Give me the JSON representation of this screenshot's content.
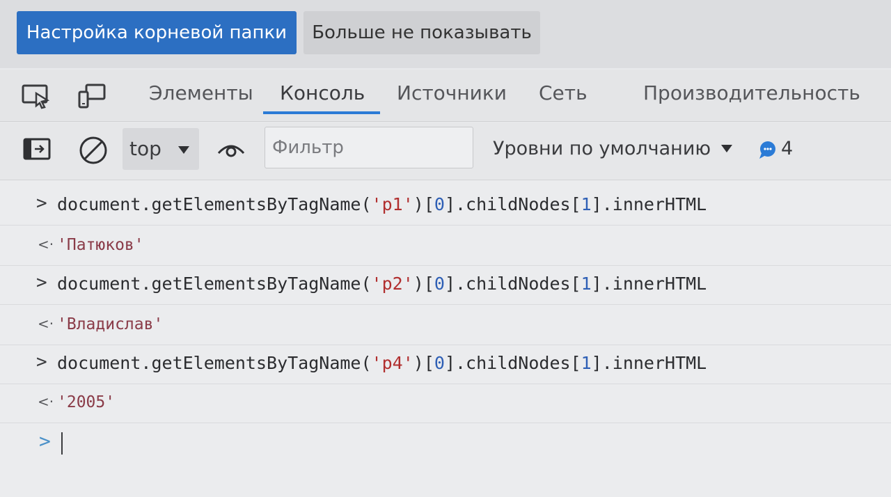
{
  "infobar": {
    "primary_button": "Настройка корневой папки",
    "secondary_button": "Больше не показывать"
  },
  "tabs": {
    "items": [
      "Элементы",
      "Консоль",
      "Источники",
      "Сеть",
      "Производительность"
    ],
    "active": "Консоль"
  },
  "toolbar": {
    "context": "top",
    "filter_placeholder": "Фильтр",
    "levels": "Уровни по умолчанию",
    "message_count": "4"
  },
  "console": {
    "entries": [
      {
        "input": {
          "pre": "document.getElementsByTagName(",
          "arg": "'p1'",
          "mid": ")[",
          "index": "0",
          "mid2": "].childNodes[",
          "index2": "1",
          "post": "].innerHTML"
        },
        "result": "'Патюков'"
      },
      {
        "input": {
          "pre": "document.getElementsByTagName(",
          "arg": "'p2'",
          "mid": ")[",
          "index": "0",
          "mid2": "].childNodes[",
          "index2": "1",
          "post": "].innerHTML"
        },
        "result": "'Владислав'"
      },
      {
        "input": {
          "pre": "document.getElementsByTagName(",
          "arg": "'p4'",
          "mid": ")[",
          "index": "0",
          "mid2": "].childNodes[",
          "index2": "1",
          "post": "].innerHTML"
        },
        "result": "'2005'"
      }
    ],
    "prompt_symbol": ">",
    "result_symbol": "<·"
  },
  "colors": {
    "accent": "#2b7bd6",
    "primary_button": "#2c6fc2",
    "string": "#b12f2f",
    "number": "#2e5fb5",
    "result_string": "#8a3b48"
  },
  "icons": [
    "inspect-element-icon",
    "device-emulation-icon",
    "sidebar-toggle-icon",
    "clear-console-icon",
    "eye-icon",
    "message-bubble-icon"
  ]
}
